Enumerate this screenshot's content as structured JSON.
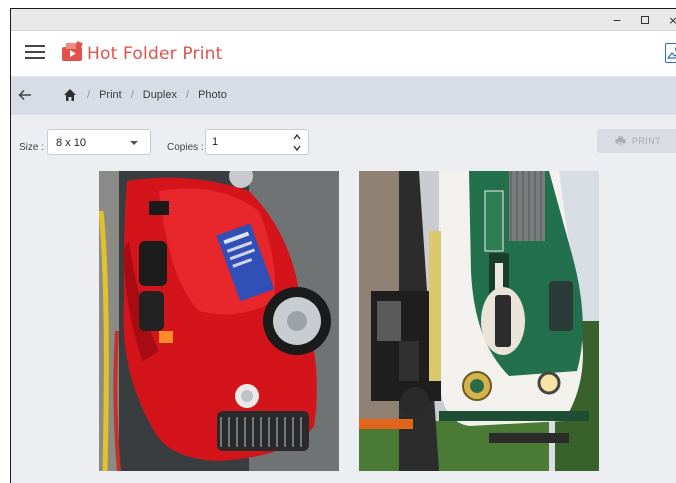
{
  "window": {
    "controls": {
      "minimize": "−",
      "maximize": "",
      "close": "×"
    }
  },
  "app": {
    "brand": "Hot Folder Print",
    "brand_color": "#e0524a",
    "menu_icon": "hamburger-menu-icon",
    "logo_icon": "printer-logo-icon",
    "right_icon": "image-icon"
  },
  "breadcrumb": {
    "back_icon": "arrow-left-icon",
    "home_icon": "home-icon",
    "items": [
      "Print",
      "Duplex",
      "Photo"
    ],
    "separator": "/"
  },
  "toolbar": {
    "size_label": "Size :",
    "size_value": "8 x 10",
    "copies_label": "Copies :",
    "copies_value": "1",
    "print_label": "PRINT",
    "print_icon": "printer-icon",
    "print_enabled": false
  },
  "photos": [
    {
      "subject": "red vintage hot rod car"
    },
    {
      "subject": "green and white Southern locomotive 6901"
    }
  ]
}
